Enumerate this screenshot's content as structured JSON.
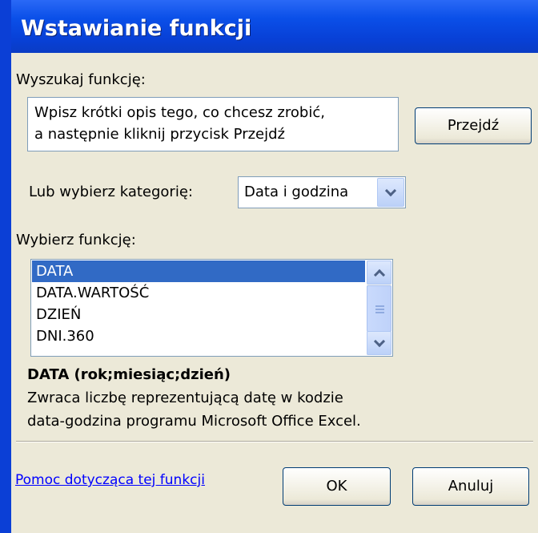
{
  "dialog": {
    "title": "Wstawianie funkcji"
  },
  "search": {
    "label": "Wyszukaj funkcję:",
    "text_line1": "Wpisz krótki opis tego, co chcesz zrobić,",
    "text_line2": "a następnie kliknij przycisk Przejdź",
    "go_label": "Przejdź"
  },
  "category": {
    "label": "Lub wybierz kategorię:",
    "selected": "Data i godzina"
  },
  "functions": {
    "label": "Wybierz funkcję:",
    "items": [
      "DATA",
      "DATA.WARTOŚĆ",
      "DZIEŃ",
      "DNI.360"
    ],
    "selected_index": 0
  },
  "description": {
    "signature": "DATA (rok;miesiąc;dzień)",
    "text_line1": "Zwraca liczbę reprezentującą datę w kodzie",
    "text_line2": "data-godzina programu Microsoft Office Excel."
  },
  "footer": {
    "help_link": "Pomoc dotycząca tej funkcji",
    "ok_label": "OK",
    "cancel_label": "Anuluj"
  },
  "icons": {
    "dropdown": "chevron-down-icon",
    "scroll_up": "chevron-up-icon",
    "scroll_down": "chevron-down-icon",
    "thumb_grip": "grip-icon"
  },
  "colors": {
    "titlebar": "#0a4fe8",
    "selection": "#316ac5",
    "link": "#0000ff",
    "dialog_bg": "#ece9d8"
  }
}
